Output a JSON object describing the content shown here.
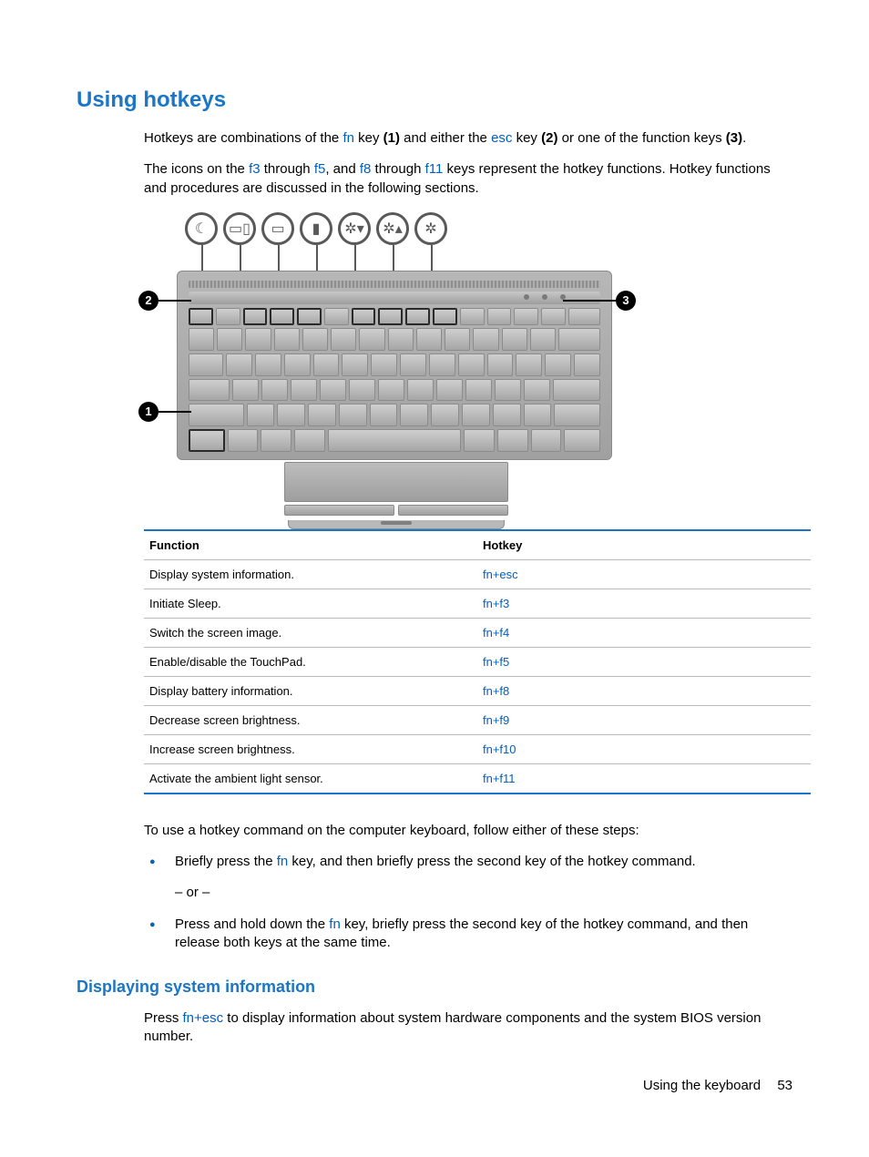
{
  "headings": {
    "h1": "Using hotkeys",
    "h2": "Displaying system information"
  },
  "intro": {
    "p1_pre": "Hotkeys are combinations of the ",
    "fn": "fn",
    "p1_mid1": " key ",
    "b1": "(1)",
    "p1_mid2": " and either the ",
    "esc": "esc",
    "p1_mid3": " key ",
    "b2": "(2)",
    "p1_mid4": " or one of the function keys ",
    "b3": "(3)",
    "p1_end": ".",
    "p2_pre": "The icons on the ",
    "f3": "f3",
    "p2_a": " through ",
    "f5": "f5",
    "p2_b": ", and ",
    "f8": "f8",
    "p2_c": " through ",
    "f11": "f11",
    "p2_d": " keys represent the hotkey functions. Hotkey functions and procedures are discussed in the following sections."
  },
  "callouts": {
    "c1": "1",
    "c2": "2",
    "c3": "3"
  },
  "table": {
    "headers": {
      "func": "Function",
      "hotkey": "Hotkey"
    },
    "rows": [
      {
        "func": "Display system information.",
        "hotkey": "fn+esc"
      },
      {
        "func": "Initiate Sleep.",
        "hotkey": "fn+f3"
      },
      {
        "func": "Switch the screen image.",
        "hotkey": "fn+f4"
      },
      {
        "func": "Enable/disable the TouchPad.",
        "hotkey": "fn+f5"
      },
      {
        "func": "Display battery information.",
        "hotkey": "fn+f8"
      },
      {
        "func": "Decrease screen brightness.",
        "hotkey": "fn+f9"
      },
      {
        "func": "Increase screen brightness.",
        "hotkey": "fn+f10"
      },
      {
        "func": "Activate the ambient light sensor.",
        "hotkey": "fn+f11"
      }
    ]
  },
  "steps": {
    "lede": "To use a hotkey command on the computer keyboard, follow either of these steps:",
    "b1_pre": "Briefly press the ",
    "b1_fn": "fn",
    "b1_post": " key, and then briefly press the second key of the hotkey command.",
    "or": "– or –",
    "b2_pre": "Press and hold down the ",
    "b2_fn": "fn",
    "b2_post": " key, briefly press the second key of the hotkey command, and then release both keys at the same time."
  },
  "sysinfo": {
    "p_pre": "Press ",
    "combo": "fn+esc",
    "p_post": " to display information about system hardware components and the system BIOS version number."
  },
  "footer": {
    "label": "Using the keyboard",
    "page": "53"
  }
}
